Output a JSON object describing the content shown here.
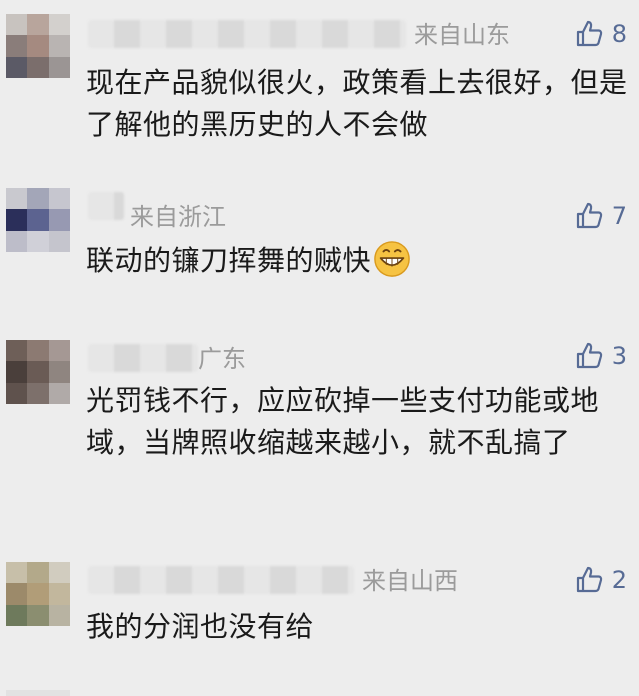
{
  "comments": [
    {
      "location": "来自山东",
      "likes": "8",
      "text": "现在产品貌似很火，政策看上去很好，但是了解他的黑历史的人不会做"
    },
    {
      "location": "来自浙江",
      "likes": "7",
      "text": "联动的镰刀挥舞的贼快",
      "emoji": "grin-emoji"
    },
    {
      "location": "广东",
      "likes": "3",
      "text": "光罚钱不行，应应砍掉一些支付功能或地域，当牌照收缩越来越小，就不乱搞了"
    },
    {
      "location": "来自山西",
      "likes": "2",
      "text": "我的分润也没有给"
    }
  ],
  "icons": {
    "like": "thumbs-up-icon"
  },
  "colors": {
    "background": "#ededed",
    "link_blue": "#576b95",
    "location_gray": "#9b9b9b",
    "body_text": "#1a1a1a"
  }
}
